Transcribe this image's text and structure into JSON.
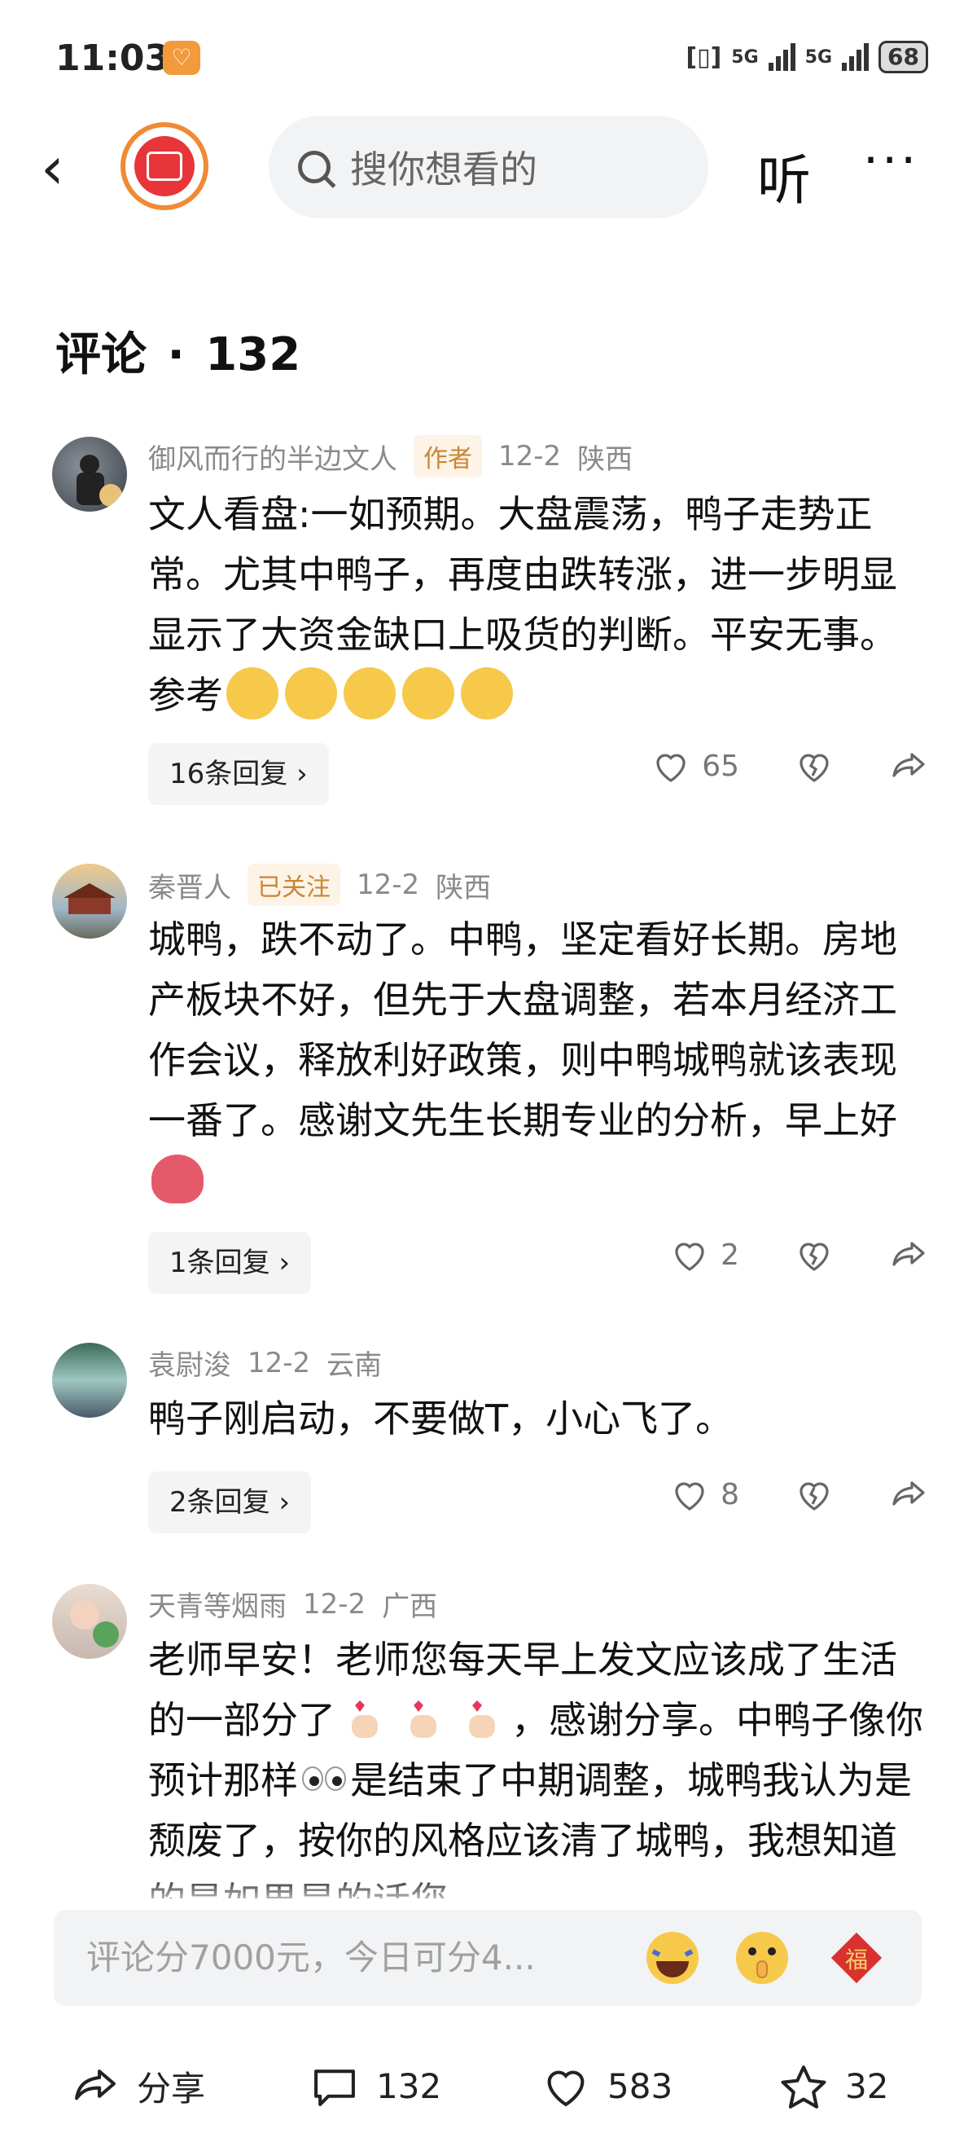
{
  "status": {
    "time": "11:03",
    "net1": "5G",
    "net2": "5G",
    "battery": "68"
  },
  "search": {
    "placeholder": "搜你想看的"
  },
  "topbar": {
    "listen_label": "听"
  },
  "comments_header": {
    "label": "评论",
    "sep": "·",
    "count": "132"
  },
  "comments": [
    {
      "user": "御风而行的半边文人",
      "tag": "作者",
      "date": "12-2",
      "location": "陕西",
      "text": "文人看盘:一如预期。大盘震荡，鸭子走势正常。尤其中鸭子，再度由跌转涨，进一步明显显示了大资金缺口上吸货的判断。平安无事。参考",
      "replies": "16条回复",
      "likes": "65"
    },
    {
      "user": "秦晋人",
      "tag": "已关注",
      "date": "12-2",
      "location": "陕西",
      "text": "城鸭，跌不动了。中鸭，坚定看好长期。房地产板块不好，但先于大盘调整，若本月经济工作会议，释放利好政策，则中鸭城鸭就该表现一番了。感谢文先生长期专业的分析，早上好",
      "replies": "1条回复",
      "likes": "2"
    },
    {
      "user": "袁尉浚",
      "date": "12-2",
      "location": "云南",
      "text": "鸭子刚启动，不要做T，小心飞了。",
      "replies": "2条回复",
      "likes": "8"
    },
    {
      "user": "天青等烟雨",
      "date": "12-2",
      "location": "广西",
      "text_a": "老师早安！老师您每天早上发文应该成了生活的一部分了",
      "text_b": "，感谢分享。中鸭子像你预计那样",
      "text_c": "是结束了中期调整，城鸭我认为是颓废了，按你的风格应该清了城鸭，我想知道的是如果是的话您"
    }
  ],
  "input": {
    "placeholder": "评论分7000元，今日可分4..."
  },
  "bottom": {
    "share": "分享",
    "comments": "132",
    "likes": "583",
    "stars": "32"
  }
}
